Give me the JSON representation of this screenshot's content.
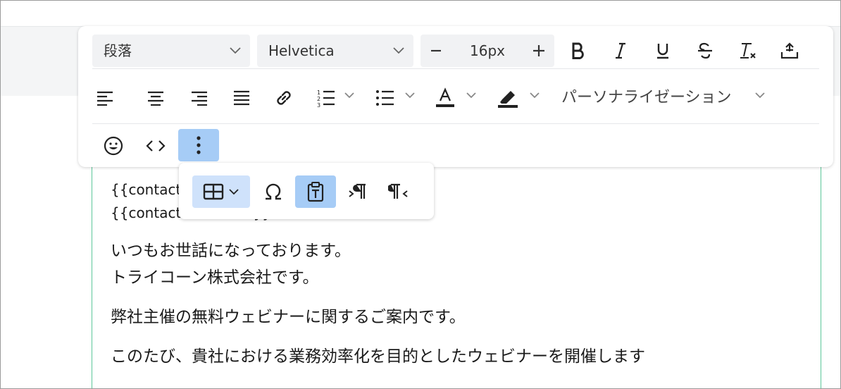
{
  "toolbar": {
    "block_format": "段落",
    "font_family": "Helvetica",
    "font_size": "16px",
    "personalization_label": "パーソナライゼーション"
  },
  "content": {
    "line1": "{{contact.lastname}}",
    "line2": "{{contact.firstname}}様",
    "para1_line1": "いつもお世話になっております。",
    "para1_line2": "トライコーン株式会社です。",
    "para2": "弊社主催の無料ウェビナーに関するご案内です。",
    "para3_partial": "このたび、貴社における業務効率化を目的としたウェビナーを開催します"
  },
  "colors": {
    "active_button": "#a6ccf6",
    "editor_border": "#5cc79a"
  }
}
